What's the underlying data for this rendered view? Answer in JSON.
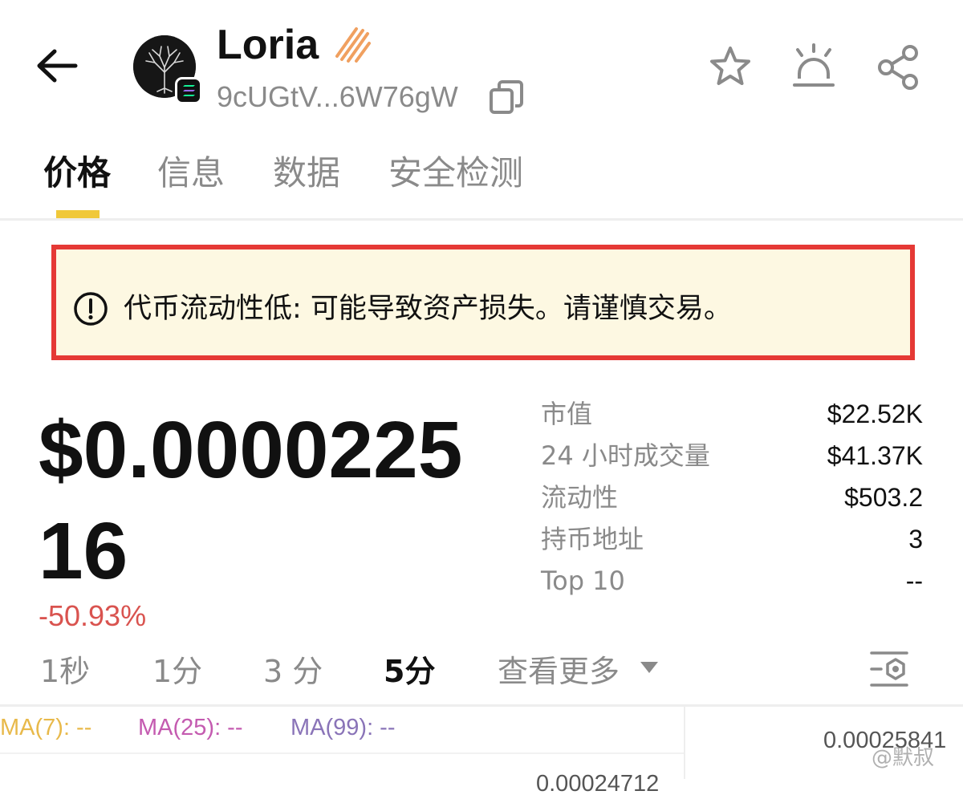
{
  "header": {
    "token_name": "Loria",
    "address": "9cUGtV...6W76gW",
    "icons": [
      "back-arrow-icon",
      "token-avatar",
      "solana-chain-icon",
      "flame-icon",
      "copy-icon",
      "star-icon",
      "price-alert-icon",
      "share-icon"
    ]
  },
  "tabs": [
    {
      "label": "价格",
      "active": true
    },
    {
      "label": "信息",
      "active": false
    },
    {
      "label": "数据",
      "active": false
    },
    {
      "label": "安全检测",
      "active": false
    }
  ],
  "warning": {
    "text": "代币流动性低: 可能导致资产损失。请谨慎交易。",
    "border_color": "#e53935",
    "background_color": "#fdf8e2"
  },
  "price": {
    "value": "$0.000022516",
    "change": "-50.93%",
    "change_color": "#d9534f"
  },
  "stats": [
    {
      "label": "市值",
      "value": "$22.52K"
    },
    {
      "label": "24 小时成交量",
      "value": "$41.37K"
    },
    {
      "label": "流动性",
      "value": "$503.2"
    },
    {
      "label": "持币地址",
      "value": "3"
    },
    {
      "label": "Top 10",
      "value": "--"
    }
  ],
  "intervals": [
    {
      "label": "1秒",
      "active": false
    },
    {
      "label": "1分",
      "active": false
    },
    {
      "label": "3 分",
      "active": false
    },
    {
      "label": "5分",
      "active": true
    }
  ],
  "more_label": "查看更多",
  "chart": {
    "ma7": "MA(7): --",
    "ma25": "MA(25): --",
    "ma99": "MA(99): --",
    "ma7_color": "#e8b94a",
    "ma25_color": "#c45bb0",
    "ma99_color": "#8a74b8",
    "axis_price_top": "0.00025841",
    "axis_price_next": "0.00024712"
  },
  "watermark": "@默叔",
  "accent_color": "#f0c83a"
}
